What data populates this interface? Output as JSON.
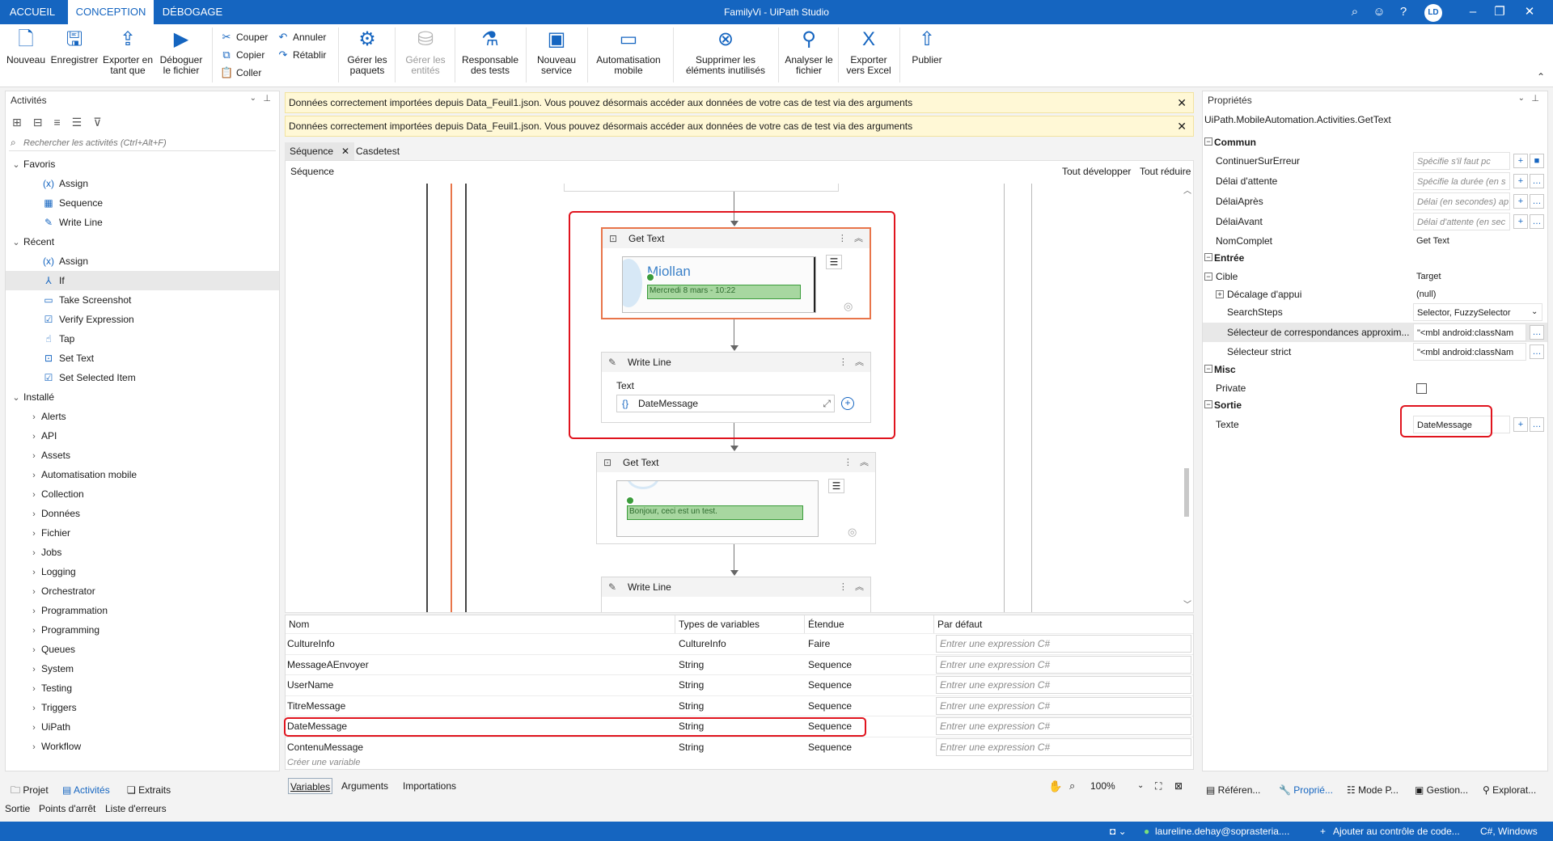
{
  "title_bar": {
    "tabs": [
      "ACCUEIL",
      "CONCEPTION",
      "DÉBOGAGE"
    ],
    "window_title": "FamilyVi - UiPath Studio",
    "avatar": "LD"
  },
  "ribbon": {
    "buttons": {
      "nouveau": "Nouveau",
      "enregistrer": "Enregistrer",
      "exporter_tant_que": "Exporter en tant que",
      "deboguer": "Déboguer le fichier",
      "couper": "Couper",
      "copier": "Copier",
      "coller": "Coller",
      "annuler": "Annuler",
      "retablir": "Rétablir",
      "gerer_paquets": "Gérer les paquets",
      "gerer_entites": "Gérer les entités",
      "responsable_tests": "Responsable des tests",
      "nouveau_service": "Nouveau service",
      "automatisation_mobile": "Automatisation mobile",
      "supprimer_elements": "Supprimer les éléments inutilisés",
      "analyser_fichier": "Analyser le fichier",
      "exporter_excel": "Exporter vers Excel",
      "publier": "Publier"
    }
  },
  "activities_panel": {
    "title": "Activités",
    "search_placeholder": "Rechercher les activités (Ctrl+Alt+F)",
    "tree": [
      {
        "label": "Favoris",
        "kind": "group"
      },
      {
        "label": "Assign",
        "kind": "item",
        "icon": "assign-icon"
      },
      {
        "label": "Sequence",
        "kind": "item",
        "icon": "sequence-icon"
      },
      {
        "label": "Write Line",
        "kind": "item",
        "icon": "write-line-icon"
      },
      {
        "label": "Récent",
        "kind": "group"
      },
      {
        "label": "Assign",
        "kind": "item",
        "icon": "assign-icon"
      },
      {
        "label": "If",
        "kind": "item",
        "icon": "if-icon",
        "selected": true
      },
      {
        "label": "Take Screenshot",
        "kind": "item",
        "icon": "screenshot-icon"
      },
      {
        "label": "Verify Expression",
        "kind": "item",
        "icon": "verify-icon"
      },
      {
        "label": "Tap",
        "kind": "item",
        "icon": "tap-icon"
      },
      {
        "label": "Set Text",
        "kind": "item",
        "icon": "set-text-icon"
      },
      {
        "label": "Set Selected Item",
        "kind": "item",
        "icon": "set-selected-icon"
      },
      {
        "label": "Installé",
        "kind": "group"
      },
      {
        "label": "Alerts",
        "kind": "sub"
      },
      {
        "label": "API",
        "kind": "sub"
      },
      {
        "label": "Assets",
        "kind": "sub"
      },
      {
        "label": "Automatisation mobile",
        "kind": "sub"
      },
      {
        "label": "Collection",
        "kind": "sub"
      },
      {
        "label": "Données",
        "kind": "sub"
      },
      {
        "label": "Fichier",
        "kind": "sub"
      },
      {
        "label": "Jobs",
        "kind": "sub"
      },
      {
        "label": "Logging",
        "kind": "sub"
      },
      {
        "label": "Orchestrator",
        "kind": "sub"
      },
      {
        "label": "Programmation",
        "kind": "sub"
      },
      {
        "label": "Programming",
        "kind": "sub"
      },
      {
        "label": "Queues",
        "kind": "sub"
      },
      {
        "label": "System",
        "kind": "sub"
      },
      {
        "label": "Testing",
        "kind": "sub"
      },
      {
        "label": "Triggers",
        "kind": "sub"
      },
      {
        "label": "UiPath",
        "kind": "sub"
      },
      {
        "label": "Workflow",
        "kind": "sub"
      }
    ],
    "bottom_tabs": [
      "Projet",
      "Activités",
      "Extraits"
    ]
  },
  "banners": [
    "Données correctement importées depuis Data_Feuil1.json. Vous pouvez désormais accéder aux données de votre cas de test via des arguments",
    "Données correctement importées depuis Data_Feuil1.json. Vous pouvez désormais accéder aux données de votre cas de test via des arguments"
  ],
  "doc_tabs": [
    "Séquence",
    "Casdetest"
  ],
  "designer": {
    "breadcrumb": "Séquence",
    "expand_all": "Tout développer",
    "collapse_all": "Tout réduire",
    "activities": [
      {
        "title": "Get Text",
        "screenshot_text": "Miollan",
        "selection_text": "Mercredi 8 mars - 10:22"
      },
      {
        "title": "Write Line",
        "field_label": "Text",
        "field_value": "DateMessage"
      },
      {
        "title": "Get Text",
        "selection_text": "Bonjour, ceci est un test."
      },
      {
        "title": "Write Line"
      }
    ]
  },
  "variables": {
    "columns": [
      "Nom",
      "Types de variables",
      "Étendue",
      "Par défaut"
    ],
    "rows": [
      {
        "name": "CultureInfo",
        "type": "CultureInfo",
        "scope": "Faire",
        "default": "Entrer une expression C#"
      },
      {
        "name": "MessageAEnvoyer",
        "type": "String",
        "scope": "Sequence",
        "default": "Entrer une expression C#"
      },
      {
        "name": "UserName",
        "type": "String",
        "scope": "Sequence",
        "default": "Entrer une expression C#"
      },
      {
        "name": "TitreMessage",
        "type": "String",
        "scope": "Sequence",
        "default": "Entrer une expression C#"
      },
      {
        "name": "DateMessage",
        "type": "String",
        "scope": "Sequence",
        "default": "Entrer une expression C#"
      },
      {
        "name": "ContenuMessage",
        "type": "String",
        "scope": "Sequence",
        "default": "Entrer une expression C#"
      }
    ],
    "create_placeholder": "Créer une variable",
    "footer_tabs": [
      "Variables",
      "Arguments",
      "Importations"
    ],
    "zoom": "100%"
  },
  "properties": {
    "title": "Propriétés",
    "type_name": "UiPath.MobileAutomation.Activities.GetText",
    "categories": {
      "commun": "Commun",
      "entree": "Entrée",
      "misc": "Misc",
      "sortie": "Sortie"
    },
    "fields": {
      "continuer_label": "ContinuerSurErreur",
      "continuer_placeholder": "Spécifie s'il faut pc",
      "delai_attente_label": "Délai d'attente",
      "delai_attente_placeholder": "Spécifie la durée (en s",
      "delai_apres_label": "DélaiAprès",
      "delai_apres_placeholder": "Délai (en secondes) ap",
      "delai_avant_label": "DélaiAvant",
      "delai_avant_placeholder": "Délai d'attente (en sec",
      "nom_complet_label": "NomComplet",
      "nom_complet_value": "Get Text",
      "cible_label": "Cible",
      "cible_value": "Target",
      "decalage_label": "Décalage d'appui",
      "decalage_value": "(null)",
      "searchsteps_label": "SearchSteps",
      "searchsteps_value": "Selector, FuzzySelector",
      "selecteur_approx_label": "Sélecteur de correspondances approxim...",
      "selecteur_approx_value": "\"<mbl android:classNam",
      "selecteur_strict_label": "Sélecteur strict",
      "selecteur_strict_value": "\"<mbl android:classNam",
      "private_label": "Private",
      "texte_label": "Texte",
      "texte_value": "DateMessage"
    },
    "bottom_tabs": [
      "Référen...",
      "Proprié...",
      "Mode P...",
      "Gestion...",
      "Explorat..."
    ]
  },
  "output_tabs": [
    "Sortie",
    "Points d'arrêt",
    "Liste d'erreurs"
  ],
  "status_bar": {
    "user": "laureline.dehay@soprasteria....",
    "add_source_control": "Ajouter au contrôle de code...",
    "language": "C#, Windows"
  },
  "colors": {
    "accent": "#1565c0",
    "highlight_red": "#e0141e",
    "banner_bg": "#fff8d6",
    "selection_green": "#a7d7a0"
  }
}
